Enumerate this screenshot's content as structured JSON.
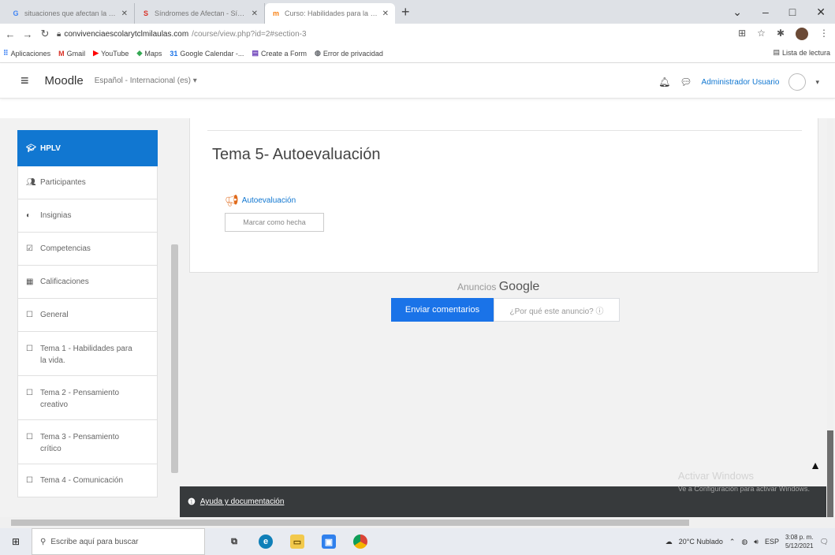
{
  "browser": {
    "tabs": [
      {
        "title": "situaciones que afectan la convi",
        "icon": "G",
        "icon_color": "#4285f4",
        "active": false
      },
      {
        "title": "Síndromes de Afectan - Síndrome",
        "icon": "S",
        "icon_color": "#d93025",
        "active": false
      },
      {
        "title": "Curso: Habilidades para la vida",
        "icon": "m",
        "icon_color": "#f98012",
        "active": true
      }
    ],
    "new_tab": "+",
    "window_controls": [
      "⌄",
      "–",
      "□",
      "✕"
    ],
    "url_host": "convivenciaescolarytclmilaulas.com",
    "url_path": "/course/view.php?id=2#section-3",
    "bookmarks": [
      {
        "label": "Aplicaciones",
        "icon": "grid-icon",
        "glyph": "⠿",
        "color": "#4285f4"
      },
      {
        "label": "Gmail",
        "icon": "gmail-icon",
        "glyph": "M",
        "color": "#d93025"
      },
      {
        "label": "YouTube",
        "icon": "youtube-icon",
        "glyph": "▶",
        "color": "#ff0000"
      },
      {
        "label": "Maps",
        "icon": "maps-icon",
        "glyph": "◆",
        "color": "#34a853"
      },
      {
        "label": "Google Calendar -...",
        "icon": "calendar-icon",
        "glyph": "31",
        "color": "#1a73e8"
      },
      {
        "label": "Create a Form",
        "icon": "forms-icon",
        "glyph": "▤",
        "color": "#673ab7"
      },
      {
        "label": "Error de privacidad",
        "icon": "globe-icon",
        "glyph": "◍",
        "color": "#5f6368"
      }
    ],
    "reading_list": "Lista de lectura"
  },
  "navbar": {
    "menu_glyph": "≡",
    "brand": "Moodle",
    "language": "Español - Internacional (es) ▾",
    "username": "Administrador Usuario",
    "user_menu_glyph": "▾"
  },
  "drawer": {
    "items": [
      {
        "label": "HPLV",
        "icon": "graduation-cap-icon",
        "glyph": "🎓",
        "active": true
      },
      {
        "label": "Participantes",
        "icon": "users-icon",
        "glyph": "👥",
        "active": false
      },
      {
        "label": "Insignias",
        "icon": "shield-icon",
        "glyph": "◐",
        "active": false
      },
      {
        "label": "Competencias",
        "icon": "checkbox-icon",
        "glyph": "☑",
        "active": false
      },
      {
        "label": "Calificaciones",
        "icon": "table-icon",
        "glyph": "▦",
        "active": false
      },
      {
        "label": "General",
        "icon": "folder-icon",
        "glyph": "☐",
        "active": false
      },
      {
        "label": "Tema 1 - Habilidades para la vida.",
        "icon": "folder-icon",
        "glyph": "☐",
        "active": false
      },
      {
        "label": "Tema 2 - Pensamiento creativo",
        "icon": "folder-icon",
        "glyph": "☐",
        "active": false
      },
      {
        "label": "Tema 3 - Pensamiento crítico",
        "icon": "folder-icon",
        "glyph": "☐",
        "active": false
      },
      {
        "label": "Tema 4 - Comunicación",
        "icon": "folder-icon",
        "glyph": "☐",
        "active": false
      }
    ]
  },
  "main": {
    "section_title": "Tema 5- Autoevaluación",
    "activity_label": "Autoevaluación",
    "mark_done_label": "Marcar como hecha",
    "ads_label": "Anuncios",
    "ads_brand": "Google",
    "send_feedback": "Enviar comentarios",
    "why_ad": "¿Por qué este anuncio? ⓘ",
    "scroll_top_glyph": "🡅"
  },
  "footer": {
    "help_link": "Ayuda y documentación"
  },
  "watermark": {
    "line1": "Activar Windows",
    "line2": "Ve a Configuración para activar Windows."
  },
  "taskbar": {
    "search_placeholder": "Escribe aquí para buscar",
    "weather": "20°C Nublado",
    "lang": "ESP",
    "time": "3:08 p. m.",
    "date": "5/12/2021"
  }
}
